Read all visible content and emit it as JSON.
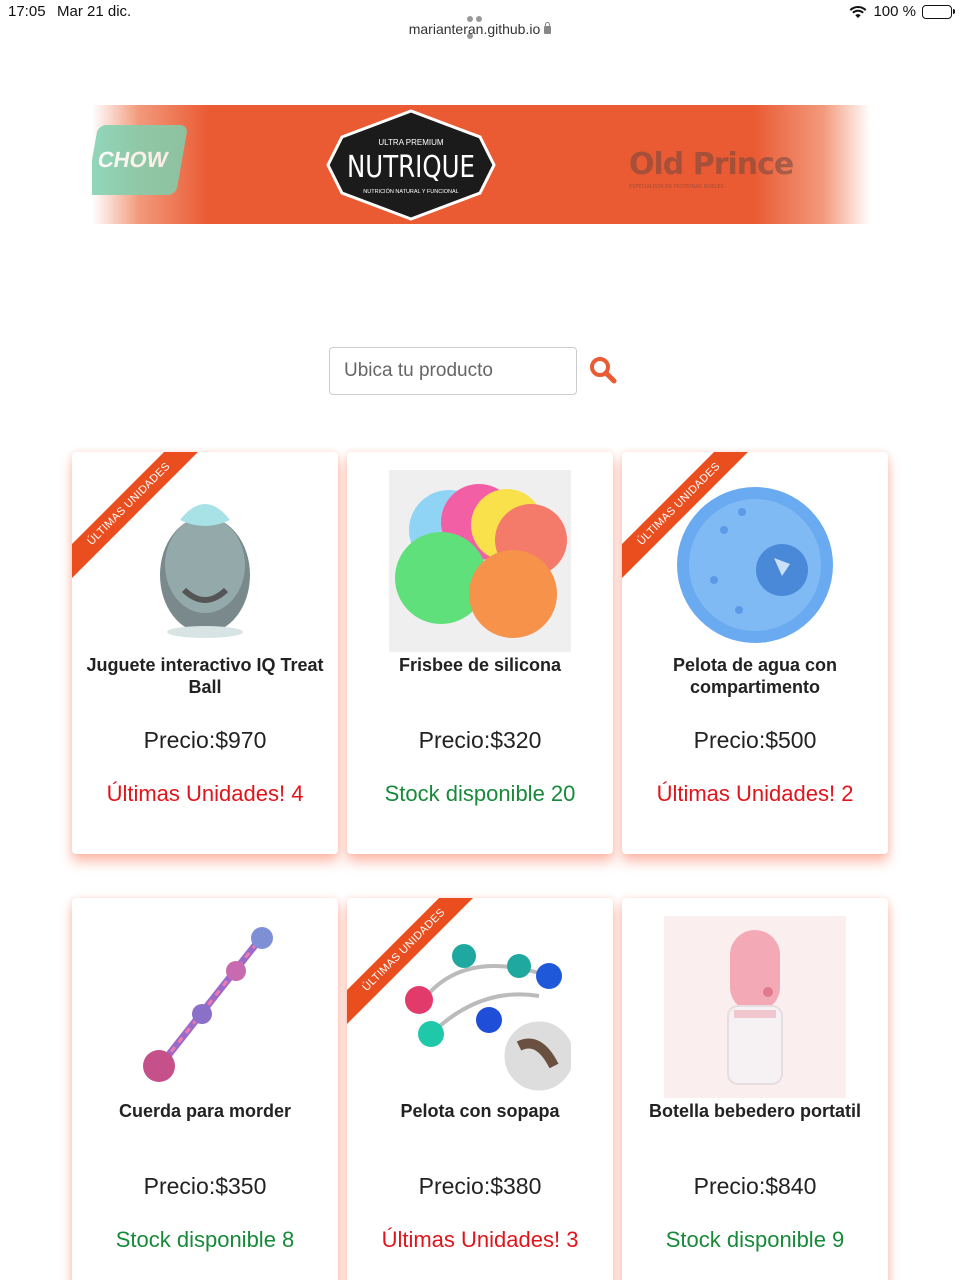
{
  "status_bar": {
    "time": "17:05",
    "date": "Mar 21 dic.",
    "battery": "100 %"
  },
  "browser": {
    "url": "marianteran.github.io"
  },
  "banner": {
    "left_brand": "CHOW",
    "center_brand": "NUTRIQUE",
    "center_top": "ULTRA PREMIUM",
    "center_bottom": "NUTRICIÓN NATURAL Y FUNCIONAL",
    "right_brand": "Old Prince",
    "right_sub": "ESPECIALISTA EN PROTEÍNAS NOBLES"
  },
  "search": {
    "placeholder": "Ubica tu producto"
  },
  "products": [
    {
      "title": "Juguete interactivo IQ Treat Ball",
      "price": "Precio:$970",
      "stock": "Últimas Unidades! 4",
      "stock_status": "low",
      "ribbon": "ÚLTIMAS UNIDADES"
    },
    {
      "title": "Frisbee de silicona",
      "price": "Precio:$320",
      "stock": "Stock disponible 20",
      "stock_status": "ok"
    },
    {
      "title": "Pelota de agua con compartimento",
      "price": "Precio:$500",
      "stock": "Últimas Unidades! 2",
      "stock_status": "low",
      "ribbon": "ÚLTIMAS UNIDADES"
    },
    {
      "title": "Cuerda para morder",
      "price": "Precio:$350",
      "stock": "Stock disponible 8",
      "stock_status": "ok"
    },
    {
      "title": "Pelota con sopapa",
      "price": "Precio:$380",
      "stock": "Últimas Unidades! 3",
      "stock_status": "low",
      "ribbon": "ÚLTIMAS UNIDADES"
    },
    {
      "title": "Botella bebedero portatil",
      "price": "Precio:$840",
      "stock": "Stock disponible 9",
      "stock_status": "ok"
    }
  ],
  "colors": {
    "accent": "#ea5a33",
    "low_stock": "#e0151b",
    "ok_stock": "#178a3a"
  }
}
